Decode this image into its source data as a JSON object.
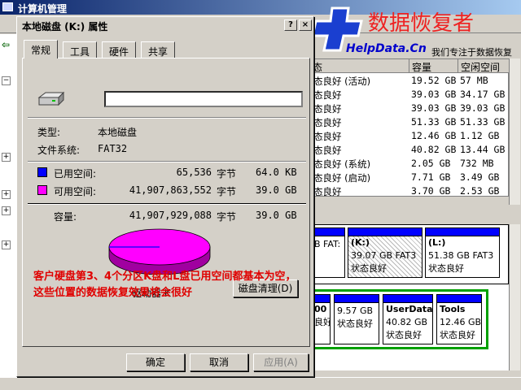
{
  "window": {
    "title": "计算机管理"
  },
  "dialog": {
    "title": "本地磁盘 (K:) 属性",
    "help_btn": "?",
    "close_btn": "×",
    "tabs": [
      "常规",
      "工具",
      "硬件",
      "共享"
    ],
    "name_value": "",
    "type_label": "类型:",
    "type_value": "本地磁盘",
    "fs_label": "文件系统:",
    "fs_value": "FAT32",
    "used_label": "已用空间:",
    "used_bytes": "65,536",
    "used_unit": "字节",
    "used_size": "64.0 KB",
    "free_label": "可用空间:",
    "free_bytes": "41,907,863,552",
    "free_unit": "字节",
    "free_size": "39.0 GB",
    "cap_label": "容量:",
    "cap_bytes": "41,907,929,088",
    "cap_unit": "字节",
    "cap_size": "39.0 GB",
    "drive_label": "驱动器 K",
    "cleanup_btn": "磁盘清理(D)",
    "ok_btn": "确定",
    "cancel_btn": "取消",
    "apply_btn": "应用(A)",
    "used_fraction": 1.6e-06,
    "colors": {
      "used": "#0000ff",
      "free": "#ff00ff"
    }
  },
  "note": "客户硬盘第3、4个分区K盘和L盘已用空间都基本为空，这些位置的数据恢复效果将会很好",
  "brand": {
    "name": "数据恢复者",
    "url": "HelpData.Cn",
    "slogan": "我们专注于数据恢复"
  },
  "volume_list": {
    "headers": [
      "态",
      "容量",
      "空闲空间"
    ],
    "rows": [
      [
        "态良好 (活动)",
        "19.52 GB",
        "57 MB"
      ],
      [
        "态良好",
        "39.03 GB",
        "34.17 GB"
      ],
      [
        "态良好",
        "39.03 GB",
        "39.03 GB"
      ],
      [
        "态良好",
        "51.33 GB",
        "51.33 GB"
      ],
      [
        "态良好",
        "12.46 GB",
        "1.12 GB"
      ],
      [
        "态良好",
        "40.82 GB",
        "13.44 GB"
      ],
      [
        "态良好 (系统)",
        "2.05 GB",
        "732 MB"
      ],
      [
        "态良好 (启动)",
        "7.71 GB",
        "3.49 GB"
      ],
      [
        "态良好",
        "3.70 GB",
        "2.53 GB"
      ]
    ]
  },
  "disk_map": {
    "row1": [
      {
        "l1": "",
        "l2": "B FAT:",
        "l3": ""
      },
      {
        "l1": "(K:)",
        "l2": "39.07 GB FAT3",
        "l3": "状态良好"
      },
      {
        "l1": "(L:)",
        "l2": "51.38 GB FAT3",
        "l3": "状态良好"
      }
    ],
    "row2": [
      {
        "l1": "00",
        "l2": "良好",
        "l3": ""
      },
      {
        "l1": "",
        "l2": "9.57 GB",
        "l3": "状态良好"
      },
      {
        "l1": "UserData",
        "l2": "40.82 GB",
        "l3": "状态良好"
      },
      {
        "l1": "Tools",
        "l2": "12.46 GB",
        "l3": "状态良好"
      }
    ]
  }
}
